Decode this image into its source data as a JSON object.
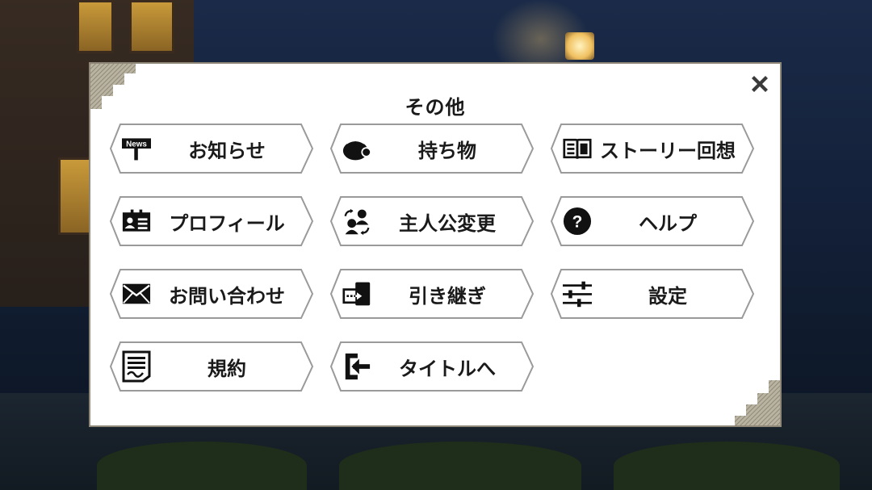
{
  "dialog": {
    "title": "その他",
    "close_icon": "close-x-icon"
  },
  "menu": [
    {
      "label": "お知らせ",
      "icon": "news-sign-icon",
      "news_badge": "News"
    },
    {
      "label": "持ち物",
      "icon": "bag-icon"
    },
    {
      "label": "ストーリー回想",
      "icon": "book-icon"
    },
    {
      "label": "プロフィール",
      "icon": "id-card-icon"
    },
    {
      "label": "主人公変更",
      "icon": "swap-character-icon"
    },
    {
      "label": "ヘルプ",
      "icon": "question-icon"
    },
    {
      "label": "お問い合わせ",
      "icon": "mail-icon"
    },
    {
      "label": "引き継ぎ",
      "icon": "transfer-device-icon"
    },
    {
      "label": "設定",
      "icon": "sliders-icon"
    },
    {
      "label": "規約",
      "icon": "terms-document-icon"
    },
    {
      "label": "タイトルへ",
      "icon": "exit-to-title-icon"
    }
  ],
  "colors": {
    "panel_bg": "#ffffff",
    "panel_border": "#8f8878",
    "button_border": "#9a9a9a",
    "text": "#1a1a1a"
  }
}
